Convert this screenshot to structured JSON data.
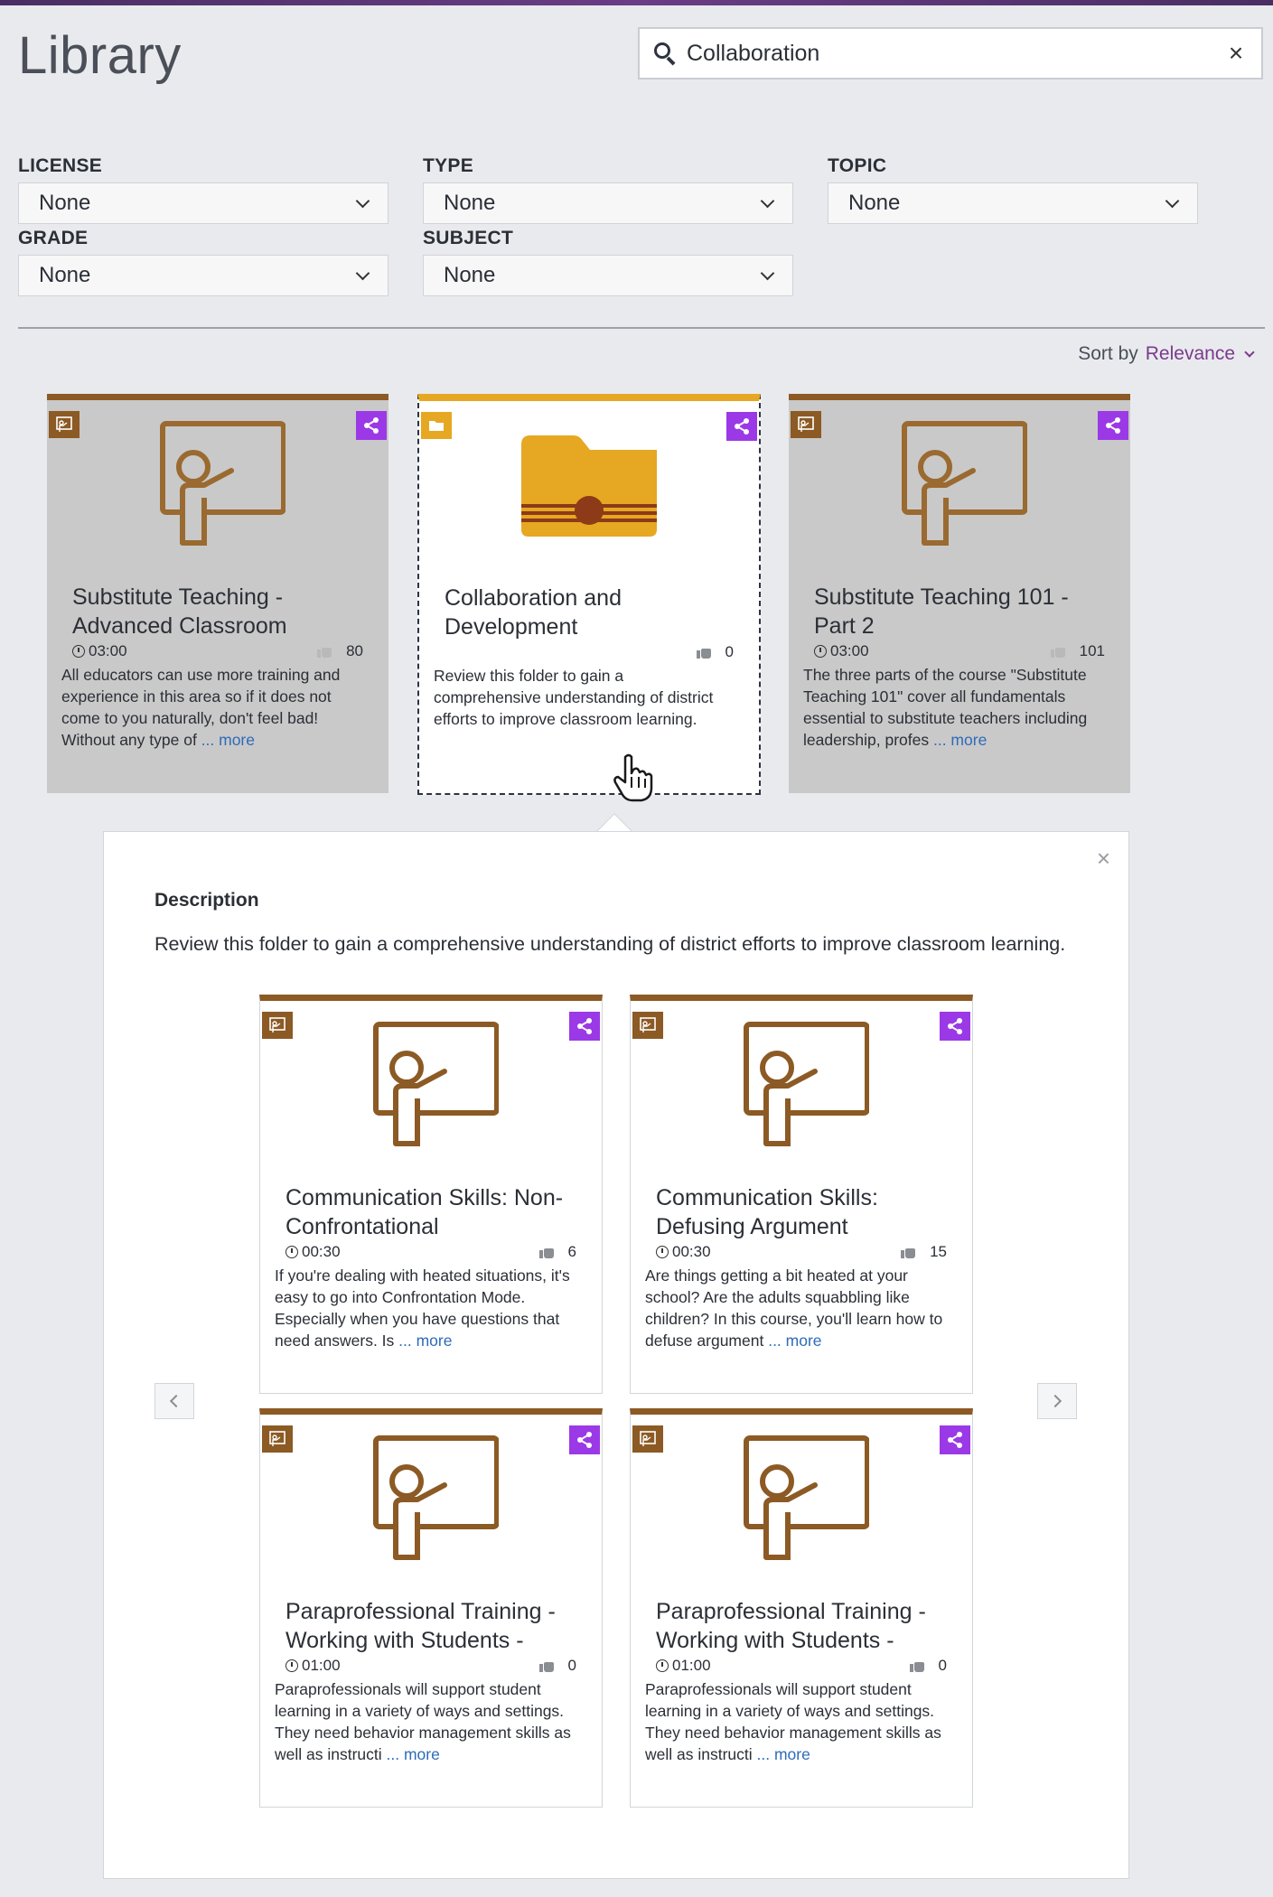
{
  "page_title": "Library",
  "search": {
    "value": "Collaboration",
    "clear_icon": "×"
  },
  "filters": [
    {
      "label": "LICENSE",
      "value": "None"
    },
    {
      "label": "TYPE",
      "value": "None"
    },
    {
      "label": "TOPIC",
      "value": "None"
    },
    {
      "label": "GRADE",
      "value": "None"
    },
    {
      "label": "SUBJECT",
      "value": "None"
    }
  ],
  "sort": {
    "label": "Sort by",
    "value": "Relevance"
  },
  "results": [
    {
      "title_1": "Substitute Teaching -",
      "title_2": "Advanced Classroom",
      "duration": "03:00",
      "likes": "80",
      "desc_1": "All educators can use more training and",
      "desc_2": "experience in this area so if it does not",
      "desc_3": "come to you naturally, don't feel bad!",
      "desc_4": "Without any type of ",
      "more": "... more"
    },
    {
      "title_1": "Collaboration and",
      "title_2": "Development",
      "likes": "0",
      "desc_1": "Review this folder to gain a",
      "desc_2": "comprehensive understanding of district",
      "desc_3": "efforts to improve classroom learning."
    },
    {
      "title_1": "Substitute Teaching 101 -",
      "title_2": "Part 2",
      "duration": "03:00",
      "likes": "101",
      "desc_1": "The three parts of the course \"Substitute",
      "desc_2": "Teaching 101\" cover all fundamentals",
      "desc_3": "essential to substitute teachers including",
      "desc_4": "leadership, profes ",
      "more": "... more"
    }
  ],
  "panel": {
    "title": "Description",
    "description": "Review this folder to gain a comprehensive understanding of district efforts to improve classroom learning.",
    "close_icon": "×",
    "items": [
      {
        "title_1": "Communication Skills: Non-",
        "title_2": "Confrontational",
        "duration": "00:30",
        "likes": "6",
        "desc_1": "If you're dealing with heated situations, it's",
        "desc_2": "easy to go into Confrontation Mode.",
        "desc_3": "Especially when you have questions that",
        "desc_4": "need answers. Is ",
        "more": "... more"
      },
      {
        "title_1": "Communication Skills:",
        "title_2": "Defusing Argument",
        "duration": "00:30",
        "likes": "15",
        "desc_1": "Are things getting a bit heated at your",
        "desc_2": "school? Are the adults squabbling like",
        "desc_3": "children? In this course, you'll learn how to",
        "desc_4": "defuse argument ",
        "more": "... more"
      },
      {
        "title_1": "Paraprofessional Training -",
        "title_2": "Working with Students -",
        "duration": "01:00",
        "likes": "0",
        "desc_1": "Paraprofessionals will support student",
        "desc_2": "learning in a variety of ways and settings.",
        "desc_3": "They need behavior management skills as",
        "desc_4": "well as instructi ",
        "more": "... more"
      },
      {
        "title_1": "Paraprofessional Training -",
        "title_2": "Working with Students -",
        "duration": "01:00",
        "likes": "0",
        "desc_1": "Paraprofessionals will support student",
        "desc_2": "learning in a variety of ways and settings.",
        "desc_3": "They need behavior management skills as",
        "desc_4": "well as instructi ",
        "more": "... more"
      }
    ]
  },
  "colors": {
    "accent_purple": "#9b39e6",
    "brand_brown": "#8c5a24",
    "folder_yellow": "#e6a722",
    "link_blue": "#2e6bb8",
    "sort_purple": "#7b3a8c"
  },
  "icons": [
    "search-icon",
    "clear-icon",
    "chevron-down-icon",
    "share-icon",
    "teacher-icon",
    "folder-icon",
    "clock-icon",
    "thumbs-up-icon",
    "close-icon",
    "chevron-left-icon",
    "chevron-right-icon",
    "hand-cursor-icon"
  ]
}
